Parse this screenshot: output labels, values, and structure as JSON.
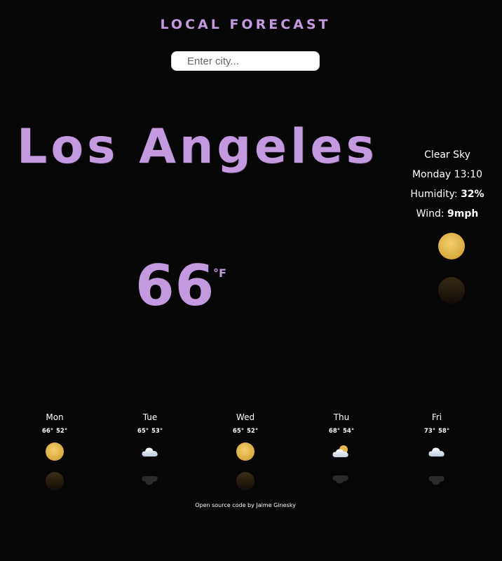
{
  "header": {
    "title": "LOCAL FORECAST"
  },
  "search": {
    "placeholder": "Enter city..."
  },
  "current": {
    "city": "Los Angeles",
    "temperature": "66",
    "unit": "°F",
    "condition": "Clear Sky",
    "datetime": "Monday 13:10",
    "humidity_label": "Humidity:",
    "humidity_value": "32%",
    "wind_label": "Wind:",
    "wind_value": "9mph",
    "icon": "sun-icon"
  },
  "forecast": [
    {
      "day": "Mon",
      "high": "66°",
      "low": "52°",
      "icon": "sun-icon"
    },
    {
      "day": "Tue",
      "high": "65°",
      "low": "53°",
      "icon": "cloud-icon"
    },
    {
      "day": "Wed",
      "high": "65°",
      "low": "52°",
      "icon": "sun-icon"
    },
    {
      "day": "Thu",
      "high": "68°",
      "low": "54°",
      "icon": "partly-cloudy-icon"
    },
    {
      "day": "Fri",
      "high": "73°",
      "low": "58°",
      "icon": "cloud-icon"
    }
  ],
  "footer": {
    "text": "Open source code by Jaime Ginesky"
  },
  "colors": {
    "accent": "#c39ae0",
    "background": "#060606"
  }
}
